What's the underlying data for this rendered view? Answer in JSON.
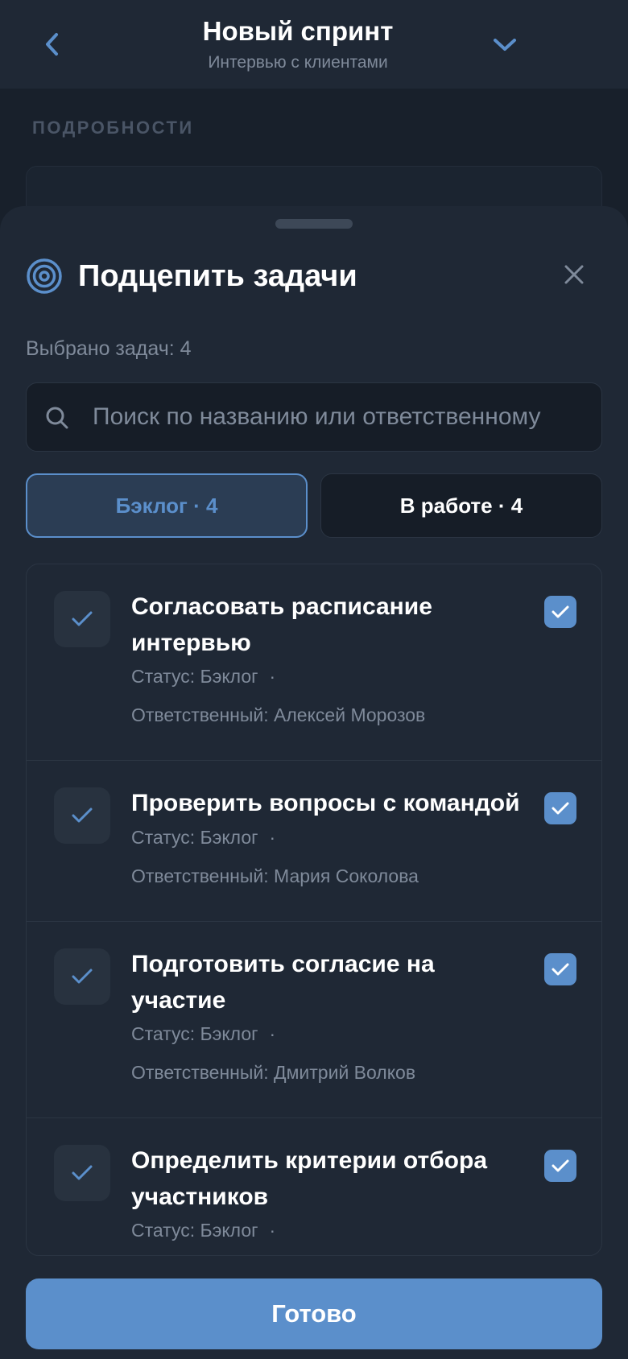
{
  "header": {
    "title": "Новый спринт",
    "subtitle": "Интервью с клиентами",
    "back_icon": "chevron-left-icon",
    "menu_icon": "chevron-down-icon"
  },
  "background": {
    "section_label": "ПОДРОБНОСТИ"
  },
  "sheet": {
    "icon": "target-icon",
    "title": "Подцепить задачи",
    "close_icon": "close-icon",
    "selected_label": "Выбрано задач: 4",
    "search": {
      "placeholder": "Поиск по названию или ответственному",
      "value": ""
    },
    "tabs": [
      {
        "label": "Бэклог · 4",
        "active": true
      },
      {
        "label": "В работе · 4",
        "active": false
      }
    ],
    "tasks": [
      {
        "title": "Согласовать расписание интервью",
        "status": "Статус: Бэклог",
        "dot": "·",
        "assignee": "Ответственный: Алексей Морозов",
        "checked": true
      },
      {
        "title": "Проверить вопросы с командой",
        "status": "Статус: Бэклог",
        "dot": "·",
        "assignee": "Ответственный: Мария Соколова",
        "checked": true
      },
      {
        "title": "Подготовить согласие на участие",
        "status": "Статус: Бэклог",
        "dot": "·",
        "assignee": "Ответственный: Дмитрий Волков",
        "checked": true
      },
      {
        "title": "Определить критерии отбора участников",
        "status": "Статус: Бэклог",
        "dot": "·",
        "assignee": "",
        "checked": true
      }
    ],
    "done_label": "Готово"
  },
  "colors": {
    "accent": "#5b8fcb",
    "background": "#18202b",
    "sheet": "#1f2835",
    "muted_text": "#7f8a9a"
  }
}
